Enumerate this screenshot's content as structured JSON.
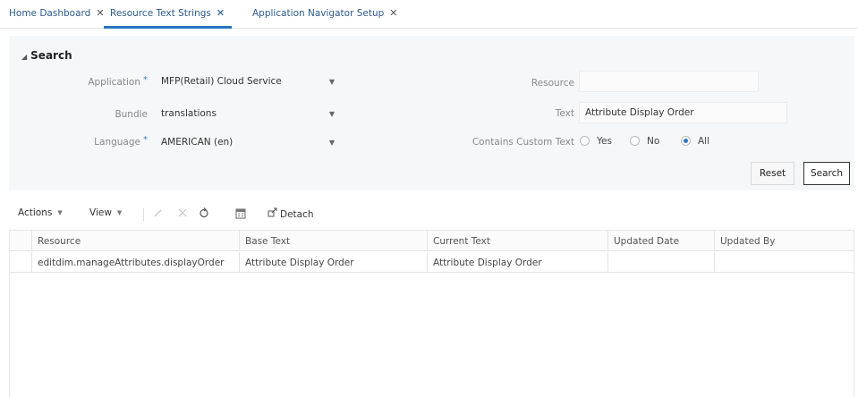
{
  "tabs": [
    {
      "label": "Home Dashboard",
      "close": "✕"
    },
    {
      "label": "Resource Text Strings",
      "close": "✕"
    },
    {
      "label": "Application Navigator Setup",
      "close": "✕"
    }
  ],
  "search": {
    "title": "Search",
    "application_label": "Application",
    "application_value": "MFP(Retail) Cloud Service",
    "bundle_label": "Bundle",
    "bundle_value": "translations",
    "language_label": "Language",
    "language_value": "AMERICAN (en)",
    "required_marker": "*",
    "resource_label": "Resource",
    "resource_value": "",
    "text_label": "Text",
    "text_value": "Attribute Display Order",
    "custom_label": "Contains Custom Text",
    "options": [
      "Yes",
      "No",
      "All"
    ],
    "selected_option": "All",
    "reset_label": "Reset",
    "search_label": "Search"
  },
  "toolbar": {
    "actions_label": "Actions",
    "view_label": "View",
    "detach_label": "Detach"
  },
  "table": {
    "columns": [
      "Resource",
      "Base Text",
      "Current Text",
      "Updated Date",
      "Updated By"
    ],
    "rows": [
      [
        "editdim.manageAttributes.displayOrder",
        "Attribute Display Order",
        "Attribute Display Order",
        "",
        ""
      ]
    ]
  },
  "colors": {
    "accent": "#2a74c2",
    "tab_text": "#2d5b8f",
    "panel_bg": "#f6f7f8"
  }
}
